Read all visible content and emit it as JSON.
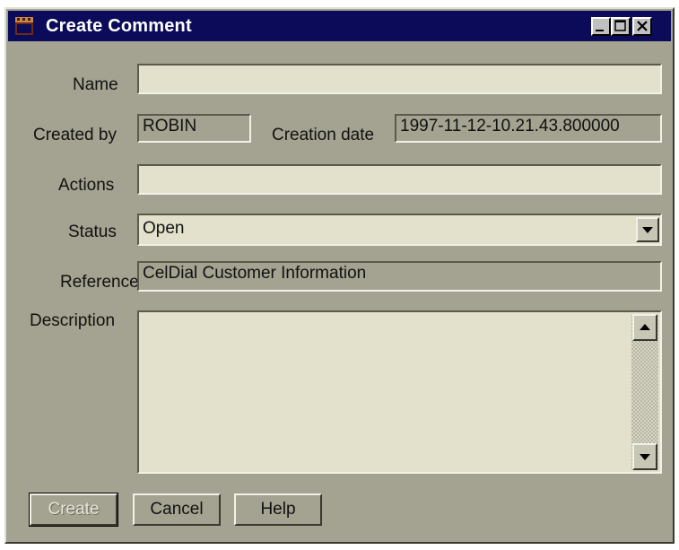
{
  "window": {
    "title": "Create Comment",
    "controls": {
      "minimize": "minimize",
      "maximize": "maximize",
      "close": "close"
    }
  },
  "form": {
    "name": {
      "label": "Name",
      "value": ""
    },
    "created_by": {
      "label": "Created by",
      "value": "ROBIN"
    },
    "creation_date": {
      "label": "Creation date",
      "value": "1997-11-12-10.21.43.800000"
    },
    "actions": {
      "label": "Actions",
      "value": ""
    },
    "status": {
      "label": "Status",
      "value": "Open"
    },
    "reference": {
      "label": "Reference",
      "value": "CelDial Customer Information"
    },
    "description": {
      "label": "Description",
      "value": ""
    }
  },
  "buttons": {
    "create": "Create",
    "cancel": "Cancel",
    "help": "Help"
  },
  "icons": {
    "app": "film-clapper-icon",
    "status_dropdown": "chevron-down-icon",
    "scroll_up": "triangle-up-icon",
    "scroll_down": "triangle-down-icon"
  },
  "colors": {
    "title_bar": "#0b0b5a",
    "window_bg": "#a4a290",
    "field_bg": "#e3e0cb"
  }
}
